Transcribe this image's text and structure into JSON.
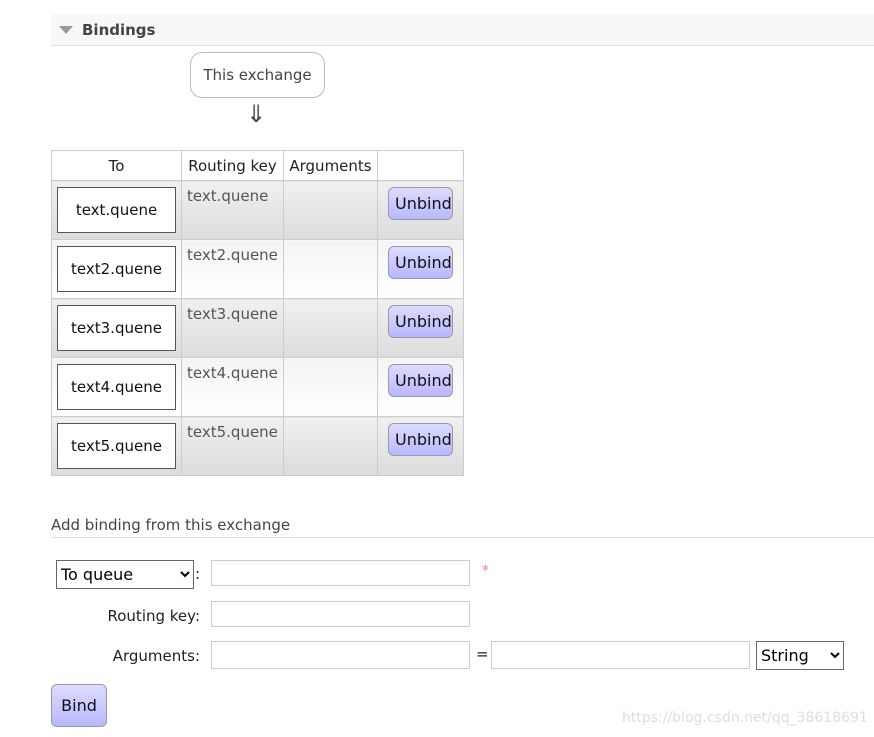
{
  "section": {
    "title": "Bindings"
  },
  "source_label": "This exchange",
  "arrow": "⇓",
  "table": {
    "headers": [
      "To",
      "Routing key",
      "Arguments",
      ""
    ],
    "rows": [
      {
        "to": "text.quene",
        "routing_key": "text.quene",
        "arguments": "",
        "action": "Unbind"
      },
      {
        "to": "text2.quene",
        "routing_key": "text2.quene",
        "arguments": "",
        "action": "Unbind"
      },
      {
        "to": "text3.quene",
        "routing_key": "text3.quene",
        "arguments": "",
        "action": "Unbind"
      },
      {
        "to": "text4.quene",
        "routing_key": "text4.quene",
        "arguments": "",
        "action": "Unbind"
      },
      {
        "to": "text5.quene",
        "routing_key": "text5.quene",
        "arguments": "",
        "action": "Unbind"
      }
    ]
  },
  "form": {
    "title": "Add binding from this exchange",
    "destination_type": "To queue",
    "colon": ":",
    "required_mark": "*",
    "routing_key_label": "Routing key:",
    "arguments_label": "Arguments:",
    "equals": "=",
    "arg_type": "String",
    "bind_label": "Bind"
  },
  "watermark": "https://blog.csdn.net/qq_38618691",
  "colors": {
    "button": "#c8c8ff",
    "required": "#f08080"
  }
}
